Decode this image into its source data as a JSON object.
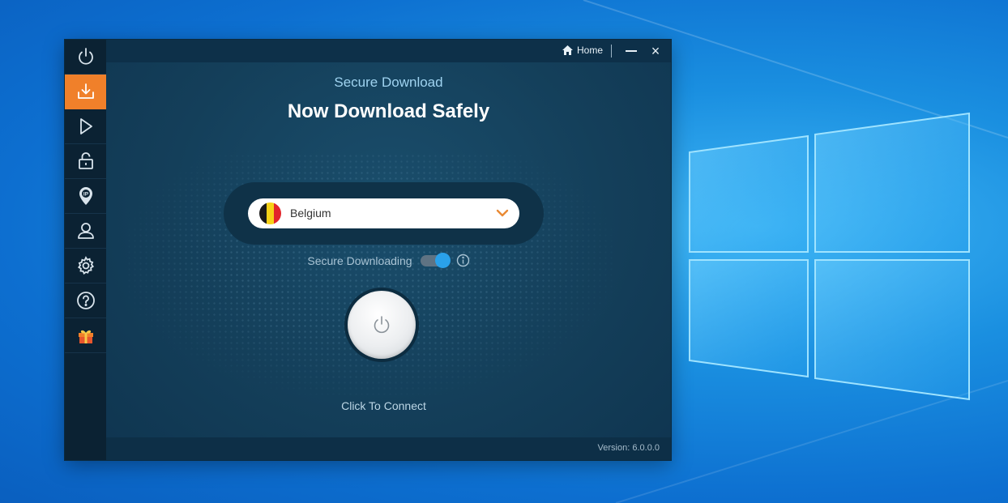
{
  "window": {
    "home_label": "Home",
    "close_glyph": "×",
    "subtitle": "Secure Download",
    "headline": "Now Download Safely"
  },
  "sidebar": {
    "items": [
      {
        "icon": "power-icon"
      },
      {
        "icon": "download-icon",
        "active": true
      },
      {
        "icon": "play-icon"
      },
      {
        "icon": "lock-icon"
      },
      {
        "icon": "ip-location-icon"
      },
      {
        "icon": "user-icon"
      },
      {
        "icon": "gear-icon"
      },
      {
        "icon": "help-icon"
      },
      {
        "icon": "gift-icon"
      }
    ]
  },
  "location": {
    "selected": "Belgium",
    "flag_colors": [
      "#1a1a1a",
      "#f7d117",
      "#e2252b"
    ]
  },
  "secure_downloading": {
    "label": "Secure Downloading",
    "enabled": true
  },
  "connect": {
    "label": "Click To Connect"
  },
  "footer": {
    "version": "Version:  6.0.0.0"
  },
  "colors": {
    "accent": "#f0802a",
    "toggle_on": "#2aa1ea",
    "desktop_blue": "#1a8fe0"
  }
}
